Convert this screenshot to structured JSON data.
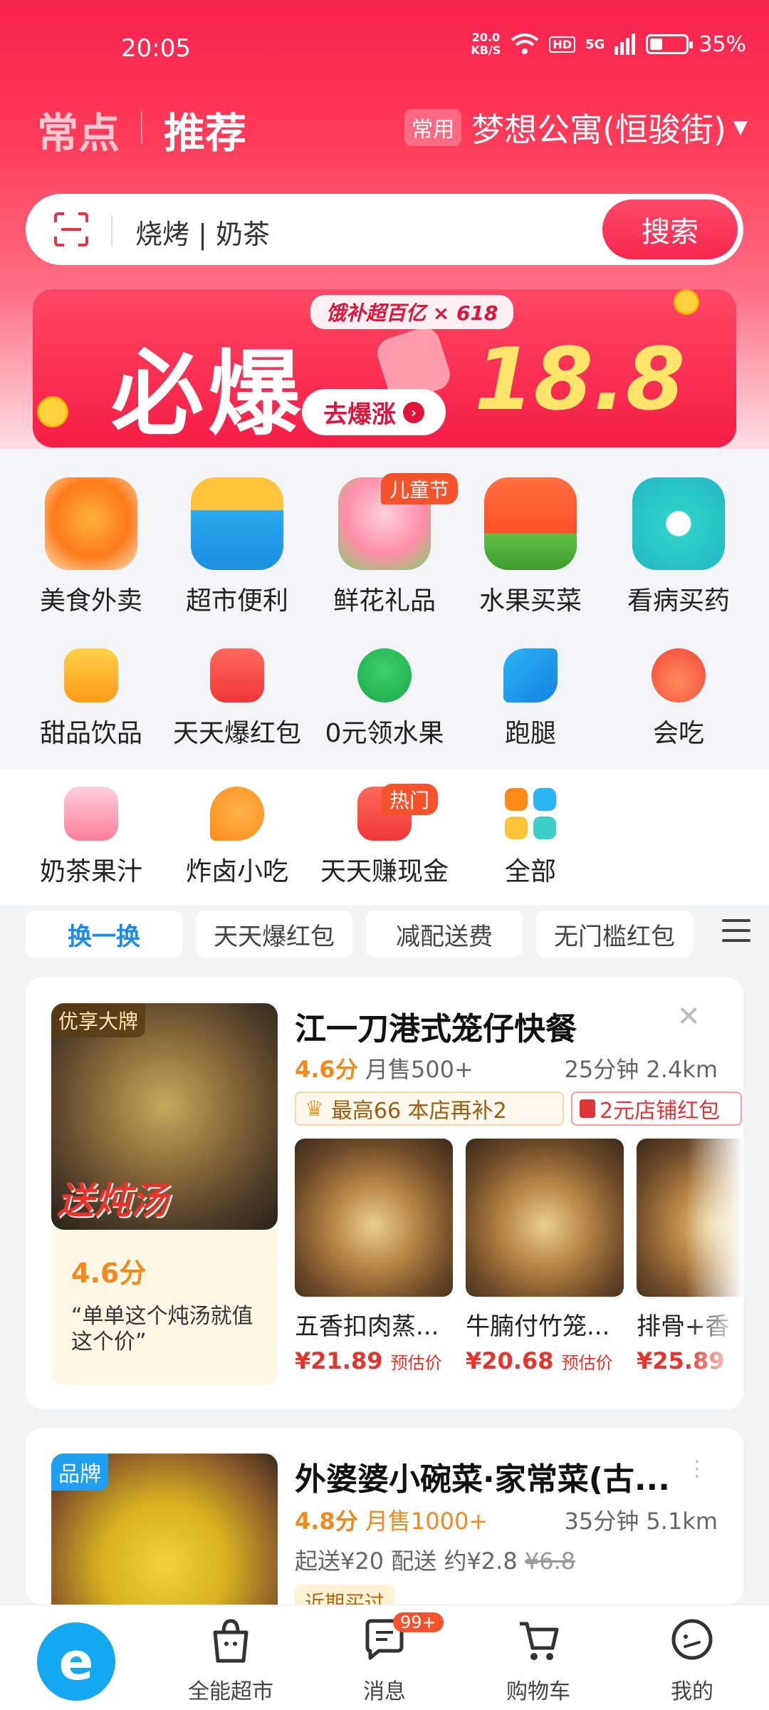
{
  "status": {
    "time": "20:05",
    "speed_top": "20.0",
    "speed_unit": "KB/S",
    "hd": "HD",
    "signal": "5G",
    "battery": "35%",
    "battery_level": 0.35
  },
  "header": {
    "tab_often": "常点",
    "tab_recommend": "推荐",
    "address_tag": "常用",
    "address": "梦想公寓(恒骏街)"
  },
  "search": {
    "placeholder": "烧烤 | 奶茶",
    "button": "搜索"
  },
  "banner": {
    "sub": "饿补超百亿 × 618",
    "main": "必爆",
    "price": "18.8元",
    "button": "去爆涨"
  },
  "categories_big": [
    {
      "label": "美食外卖",
      "icon": "food-icon"
    },
    {
      "label": "超市便利",
      "icon": "basket-icon"
    },
    {
      "label": "鲜花礼品",
      "icon": "flower-icon",
      "badge": "儿童节"
    },
    {
      "label": "水果买菜",
      "icon": "watermelon-icon"
    },
    {
      "label": "看病买药",
      "icon": "medicine-icon"
    }
  ],
  "categories_small": [
    {
      "label": "甜品饮品",
      "icon": "drink-icon"
    },
    {
      "label": "天天爆红包",
      "icon": "redpacket-icon"
    },
    {
      "label": "0元领水果",
      "icon": "tree-icon"
    },
    {
      "label": "跑腿",
      "icon": "runner-icon"
    },
    {
      "label": "会吃",
      "icon": "bowl-icon"
    },
    {
      "label": "奶茶果汁",
      "icon": "juice-icon"
    },
    {
      "label": "炸卤小吃",
      "icon": "drumstick-icon"
    },
    {
      "label": "天天赚现金",
      "icon": "cash-icon",
      "badge": "热门"
    },
    {
      "label": "全部",
      "icon": "grid-icon"
    }
  ],
  "filters": [
    "换一换",
    "天天爆红包",
    "减配送费",
    "无门槛红包"
  ],
  "card1": {
    "tag": "优享大牌",
    "image_text": "送炖汤",
    "name": "江一刀港式笼仔快餐",
    "score": "4.6分",
    "sales": "月售500+",
    "distance": "25分钟 2.4km",
    "promo1": "最高66   本店再补2",
    "promo2": "2元店铺红包",
    "review_score": "4.6分",
    "review": "“单单这个炖汤就值这个价”",
    "dishes": [
      {
        "name": "五香扣肉蒸...",
        "price": "¥21.89",
        "unit": "预估价"
      },
      {
        "name": "牛腩付竹笼...",
        "price": "¥20.68",
        "unit": "预估价"
      },
      {
        "name": "排骨+香",
        "price": "¥25.89",
        "unit": ""
      }
    ]
  },
  "card2": {
    "tag": "品牌",
    "name": "外婆婆小碗菜·家常菜(古...",
    "score": "4.8分",
    "sales": "月售1000+",
    "distance": "35分钟 5.1km",
    "min_order": "起送¥20",
    "delivery": "配送 约¥2.8",
    "old_fee": "¥6.8",
    "recent": "近期买过"
  },
  "bottom_nav": [
    {
      "label": "",
      "icon": "eleme-home-icon"
    },
    {
      "label": "全能超市",
      "icon": "bag-icon"
    },
    {
      "label": "消息",
      "icon": "message-icon",
      "badge": "99+"
    },
    {
      "label": "购物车",
      "icon": "cart-icon"
    },
    {
      "label": "我的",
      "icon": "profile-icon"
    }
  ],
  "colors": {
    "brand_red": "#f8224e",
    "accent_blue": "#14a8f2",
    "price_red": "#e8322a",
    "score_orange": "#f08a1c"
  }
}
